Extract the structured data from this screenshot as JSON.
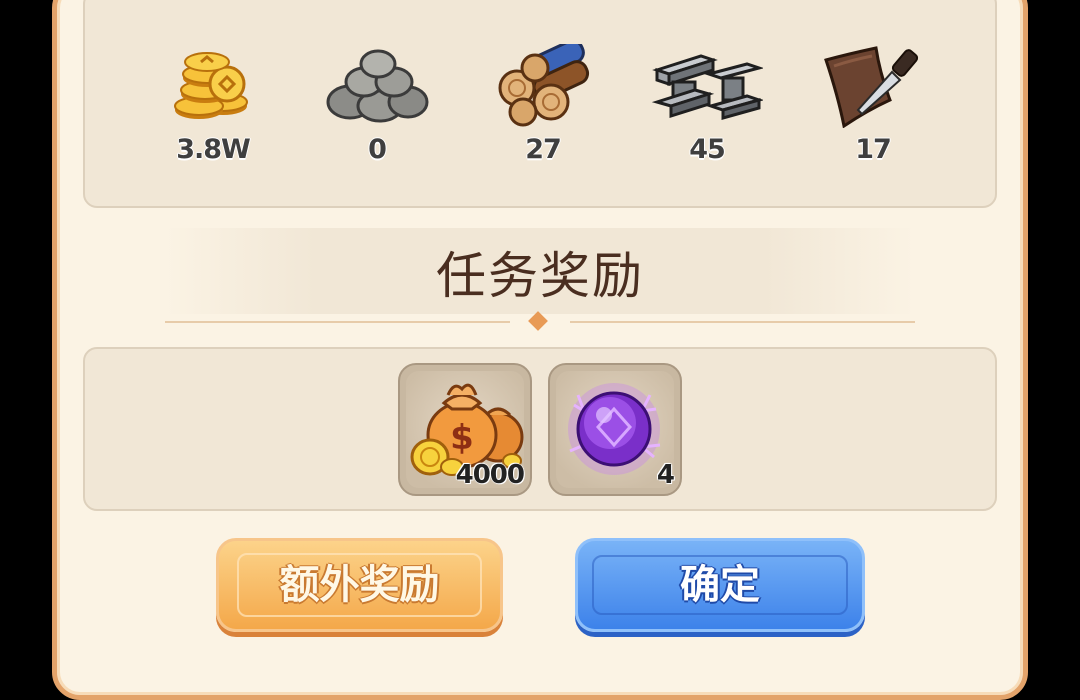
{
  "resources": [
    {
      "icon": "gold-coins-icon",
      "value": "3.8W"
    },
    {
      "icon": "stone-pile-icon",
      "value": "0"
    },
    {
      "icon": "wood-logs-icon",
      "value": "27"
    },
    {
      "icon": "iron-ingots-icon",
      "value": "45"
    },
    {
      "icon": "leather-knife-icon",
      "value": "17"
    }
  ],
  "title": "任务奖励",
  "rewards": [
    {
      "icon": "money-bags-icon",
      "count": "4000"
    },
    {
      "icon": "purple-orb-icon",
      "count": "4"
    }
  ],
  "buttons": {
    "extra_label": "额外奖励",
    "confirm_label": "确定"
  },
  "colors": {
    "panel_border": "#e3a36a",
    "panel_bg": "#fbf3e4",
    "title_text": "#4a2e20",
    "extra_button": "#f4a84a",
    "confirm_button": "#3d82ea"
  }
}
